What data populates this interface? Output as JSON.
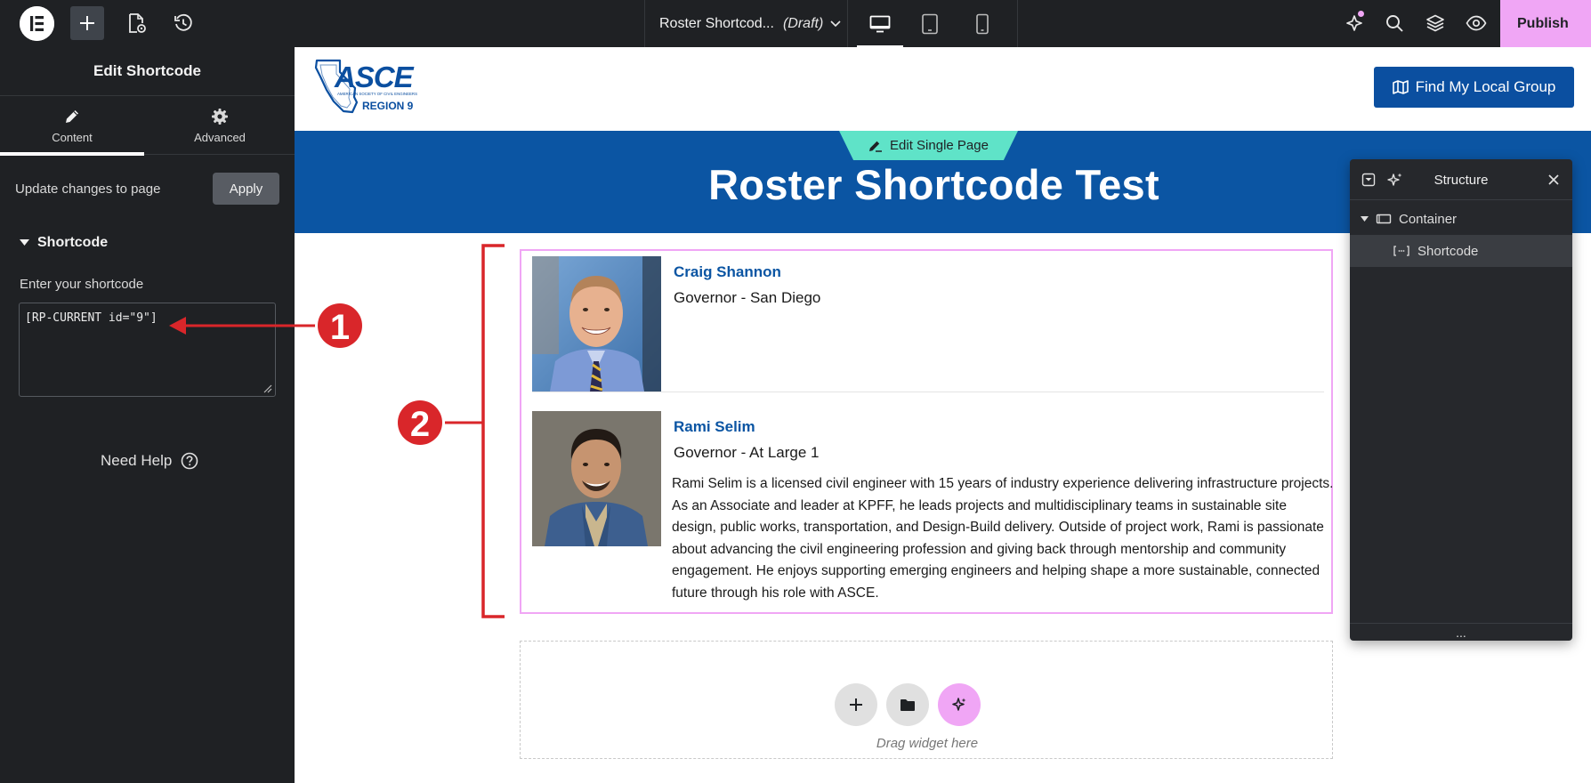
{
  "topbar": {
    "doc_title": "Roster Shortcod...",
    "doc_status": "(Draft)",
    "publish_label": "Publish",
    "icons": [
      "elementor-logo-icon",
      "add-icon",
      "page-settings-icon",
      "history-icon",
      "desktop-icon",
      "tablet-icon",
      "mobile-icon",
      "notifications-icon",
      "search-icon",
      "layers-icon",
      "preview-icon"
    ]
  },
  "panel": {
    "title": "Edit Shortcode",
    "tabs": [
      {
        "label": "Content",
        "icon": "pencil-icon"
      },
      {
        "label": "Advanced",
        "icon": "gear-icon"
      }
    ],
    "update_text": "Update changes to page",
    "apply_label": "Apply",
    "section_title": "Shortcode",
    "field_label": "Enter your shortcode",
    "shortcode_value": "[RP-CURRENT id=\"9\"]",
    "help_label": "Need Help"
  },
  "site": {
    "logo_text": "ASCE",
    "logo_subtext": "AMERICAN SOCIETY OF CIVIL ENGINEERS",
    "logo_region": "REGION 9",
    "find_button": "Find My Local Group",
    "edit_pill": "Edit Single Page",
    "page_title": "Roster Shortcode Test",
    "members": [
      {
        "name": "Craig Shannon",
        "role": "Governor - San Diego",
        "bio": ""
      },
      {
        "name": "Rami Selim",
        "role": "Governor - At Large 1",
        "bio": "Rami Selim is a licensed civil engineer with 15 years of industry experience delivering infrastructure projects. As an Associate and leader at KPFF, he leads projects and multidisciplinary teams in sustainable site design, public works, transportation, and Design-Build delivery. Outside of project work, Rami is passionate about advancing the civil engineering profession and giving back through mentorship and community engagement. He enjoys supporting emerging engineers and helping shape a more sustainable, connected future through his role with ASCE."
      }
    ],
    "dropzone_label": "Drag widget here"
  },
  "structure": {
    "title": "Structure",
    "items": [
      {
        "label": "Container",
        "icon": "container-icon"
      },
      {
        "label": "Shortcode",
        "icon": "shortcode-icon"
      }
    ],
    "more": "..."
  },
  "annotations": {
    "marker_1": "1",
    "marker_2": "2",
    "color": "#d9262a"
  },
  "colors": {
    "editor_dark": "#1f2124",
    "accent_pink": "#f0a6f5",
    "brand_blue": "#0b55a3",
    "edit_pill_teal": "#5fe3c8"
  }
}
